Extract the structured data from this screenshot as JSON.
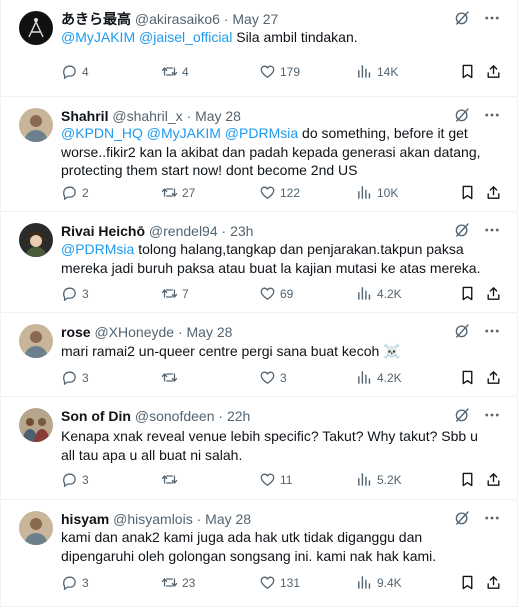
{
  "tweets": [
    {
      "user": "あきら最高",
      "handle": "@akirasaiko6",
      "time": "May 27",
      "body": [
        {
          "t": "@MyJAKIM",
          "m": true
        },
        {
          "t": " "
        },
        {
          "t": "@jaisel_official",
          "m": true
        },
        {
          "t": " Sila ambil tindakan."
        }
      ],
      "replies": "4",
      "retweets": "4",
      "likes": "179",
      "views": "14K",
      "avatar": "dark-logo-avatar"
    },
    {
      "user": "Shahril",
      "handle": "@shahril_x",
      "time": "May 28",
      "body": [
        {
          "t": "@KPDN_HQ",
          "m": true
        },
        {
          "t": " "
        },
        {
          "t": "@MyJAKIM",
          "m": true
        },
        {
          "t": " "
        },
        {
          "t": "@PDRMsia",
          "m": true
        },
        {
          "t": " do something, before it get worse..fikir2 kan la akibat dan padah kepada generasi akan datang, protecting them start now! dont become 2nd US"
        }
      ],
      "replies": "2",
      "retweets": "27",
      "likes": "122",
      "views": "10K",
      "avatar": "photo-avatar"
    },
    {
      "user": "Rivai Heichō",
      "handle": "@rendel94",
      "time": "23h",
      "body": [
        {
          "t": "@PDRMsia",
          "m": true
        },
        {
          "t": " tolong halang,tangkap dan penjarakan.takpun paksa mereka jadi buruh paksa atau buat la kajian mutasi ke atas mereka."
        }
      ],
      "replies": "3",
      "retweets": "7",
      "likes": "69",
      "views": "4.2K",
      "avatar": "anime-avatar"
    },
    {
      "user": "rose",
      "handle": "@XHoneyde",
      "time": "May 28",
      "body": [
        {
          "t": "mari ramai2 un-queer centre pergi sana buat kecoh ☠️"
        }
      ],
      "replies": "3",
      "retweets": "",
      "likes": "3",
      "views": "4.2K",
      "avatar": "photo-avatar"
    },
    {
      "user": "Son of Din",
      "handle": "@sonofdeen",
      "time": "22h",
      "body": [
        {
          "t": "Kenapa xnak reveal venue lebih specific? Takut? Why takut? Sbb u all tau apa u all buat ni salah."
        }
      ],
      "replies": "3",
      "retweets": "",
      "likes": "11",
      "views": "5.2K",
      "avatar": "group-photo-avatar"
    },
    {
      "user": "hisyam",
      "handle": "@hisyamlois",
      "time": "May 28",
      "body": [
        {
          "t": "kami dan anak2 kami juga ada hak utk tidak diganggu dan dipengaruhi oleh golongan songsang ini. kami nak hak kami."
        }
      ],
      "replies": "3",
      "retweets": "23",
      "likes": "131",
      "views": "9.4K",
      "avatar": "photo-avatar"
    }
  ],
  "separator": "·",
  "colors": {
    "mention": "#1d9bf0",
    "muted": "#536471",
    "text": "#0f1419",
    "border": "#eff3f4"
  }
}
